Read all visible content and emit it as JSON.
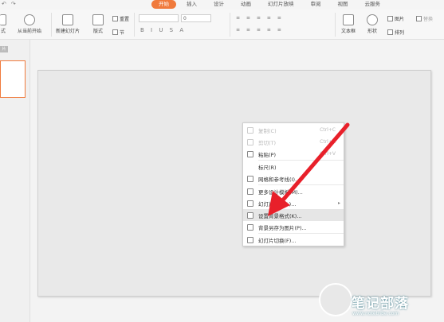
{
  "quick_access": [
    "↶",
    "↷"
  ],
  "tabs": [
    {
      "label": "开始",
      "active": true
    },
    {
      "label": "插入",
      "active": false
    },
    {
      "label": "设计",
      "active": false
    },
    {
      "label": "动画",
      "active": false
    },
    {
      "label": "幻灯片放映",
      "active": false
    },
    {
      "label": "审阅",
      "active": false
    },
    {
      "label": "视图",
      "active": false
    },
    {
      "label": "云服务",
      "active": false
    }
  ],
  "ribbon": {
    "left_cut_label": "式",
    "from_current": "从当前开始",
    "new_slide": "新建幻灯片",
    "layout": "版式",
    "reset": "重置",
    "section": "节",
    "font_name": "",
    "font_size": "0",
    "format_buttons": "B I U S A",
    "textbox": "文本框",
    "shape": "形状",
    "picture": "图片",
    "arrange": "排列",
    "replace": "替换"
  },
  "pane": {
    "tag": "片"
  },
  "context_menu": {
    "items": [
      {
        "label": "复制(C)",
        "shortcut": "Ctrl+C",
        "disabled": true,
        "icon": "copy-icon"
      },
      {
        "label": "剪切(T)",
        "shortcut": "Ctrl+X",
        "disabled": true,
        "icon": "cut-icon"
      },
      {
        "label": "粘贴(P)",
        "shortcut": "Ctrl+V",
        "disabled": false,
        "icon": "paste-icon"
      },
      {
        "label": "标尺(R)",
        "shortcut": "",
        "disabled": false,
        "icon": ""
      },
      {
        "label": "网格和参考线(I)...",
        "shortcut": "",
        "disabled": false,
        "icon": "grid-icon"
      },
      {
        "label": "更多设计模板(M)...",
        "shortcut": "",
        "disabled": false,
        "icon": "template-icon"
      },
      {
        "label": "幻灯片版式(L)...",
        "shortcut": "",
        "disabled": false,
        "icon": "layout-icon",
        "submenu": true
      },
      {
        "label": "设置背景格式(K)...",
        "shortcut": "",
        "disabled": false,
        "icon": "background-icon",
        "highlighted": true
      },
      {
        "label": "背景另存为图片(P)...",
        "shortcut": "",
        "disabled": false,
        "icon": "save-image-icon"
      },
      {
        "label": "幻灯片切换(F)...",
        "shortcut": "",
        "disabled": false,
        "icon": "transition-icon"
      }
    ]
  },
  "watermark": {
    "title": "笔记部落",
    "url": "www.notetribe.com"
  },
  "colors": {
    "accent": "#f07a3c",
    "arrow": "#e8202a"
  }
}
